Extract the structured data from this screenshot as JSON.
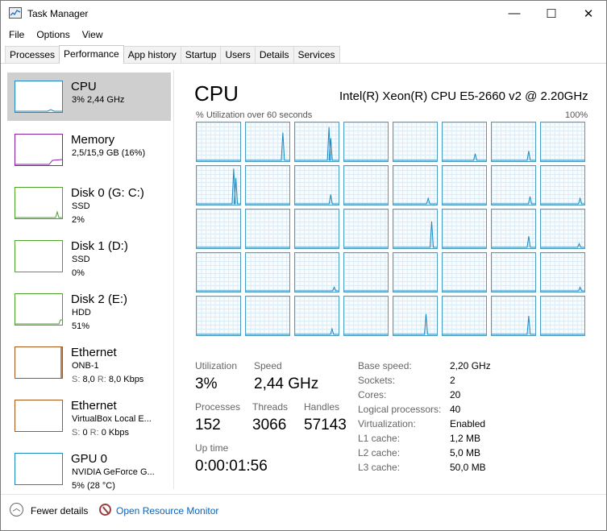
{
  "window": {
    "title": "Task Manager",
    "minimize": "—",
    "maximize": "☐",
    "close": "✕"
  },
  "menu": [
    "File",
    "Options",
    "View"
  ],
  "tabs": [
    "Processes",
    "Performance",
    "App history",
    "Startup",
    "Users",
    "Details",
    "Services"
  ],
  "active_tab": "Performance",
  "sidebar": [
    {
      "title": "CPU",
      "line1": "3% 2,44 GHz",
      "line2": "",
      "color": "#1c8ac2",
      "selected": true
    },
    {
      "title": "Memory",
      "line1": "2,5/15,9 GB (16%)",
      "line2": "",
      "color": "#8b1ea5"
    },
    {
      "title": "Disk 0 (G: C:)",
      "line1": "SSD",
      "line2": "2%",
      "color": "#4ea32a"
    },
    {
      "title": "Disk 1 (D:)",
      "line1": "SSD",
      "line2": "0%",
      "color": "#4ea32a"
    },
    {
      "title": "Disk 2 (E:)",
      "line1": "HDD",
      "line2": "51%",
      "color": "#4ea32a"
    },
    {
      "title": "Ethernet",
      "line1": "ONB-1",
      "line2": {
        "s_label": "S:",
        "s_value": "8,0",
        "r_label": "R:",
        "r_value": "8,0 Kbps"
      },
      "color": "#a7581a"
    },
    {
      "title": "Ethernet",
      "line1": "VirtualBox Local E...",
      "line2": {
        "s_label": "S:",
        "s_value": "0",
        "r_label": "R:",
        "r_value": "0 Kbps"
      },
      "color": "#a7581a"
    },
    {
      "title": "GPU 0",
      "line1": "NVIDIA GeForce G...",
      "line2": "5% (28 °C)",
      "color": "#1c8ac2"
    }
  ],
  "main": {
    "title": "CPU",
    "model": "Intel(R) Xeon(R) CPU E5-2660 v2 @ 2.20GHz",
    "graph_label": "% Utilization over 60 seconds",
    "graph_max": "100%",
    "core_count": 40
  },
  "stats": {
    "utilization_label": "Utilization",
    "utilization": "3%",
    "speed_label": "Speed",
    "speed": "2,44 GHz",
    "processes_label": "Processes",
    "processes": "152",
    "threads_label": "Threads",
    "threads": "3066",
    "handles_label": "Handles",
    "handles": "57143",
    "uptime_label": "Up time",
    "uptime": "0:00:01:56"
  },
  "details": [
    {
      "key": "Base speed:",
      "value": "2,20 GHz"
    },
    {
      "key": "Sockets:",
      "value": "2"
    },
    {
      "key": "Cores:",
      "value": "20"
    },
    {
      "key": "Logical processors:",
      "value": "40"
    },
    {
      "key": "Virtualization:",
      "value": "Enabled"
    },
    {
      "key": "L1 cache:",
      "value": "1,2 MB"
    },
    {
      "key": "L2 cache:",
      "value": "5,0 MB"
    },
    {
      "key": "L3 cache:",
      "value": "50,0 MB"
    }
  ],
  "footer": {
    "fewer_details": "Fewer details",
    "resource_monitor": "Open Resource Monitor"
  },
  "colors": {
    "cpu_line": "#1c8ac2",
    "link": "#0b62b4"
  }
}
